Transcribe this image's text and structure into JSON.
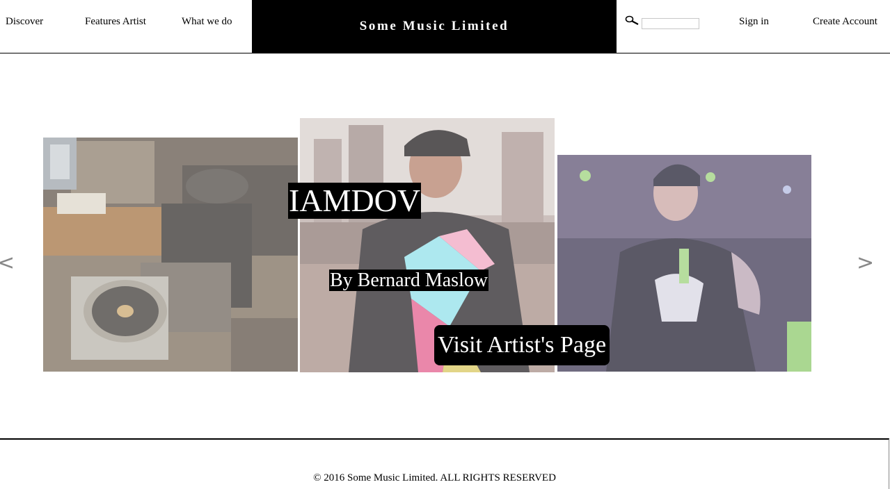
{
  "header": {
    "nav": {
      "discover": "Discover",
      "features_artist": "Features Artist",
      "what_we_do": "What we do"
    },
    "brand": "Some Music Limited",
    "search": {
      "value": "",
      "placeholder": ""
    },
    "account": {
      "sign_in": "Sign in",
      "create_account": "Create Account"
    }
  },
  "carousel": {
    "prev_label": "<",
    "next_label": ">",
    "artist_name": "IAMDOV",
    "byline": "By Bernard Maslow",
    "visit_button": "Visit Artist's Page",
    "photos": [
      {
        "subject": "man at turntable in studio"
      },
      {
        "subject": "man in cap facing skyline"
      },
      {
        "subject": "man on stage holding drink"
      }
    ]
  },
  "footer": {
    "copyright": "© 2016 Some Music Limited. ALL RIGHTS RESERVED"
  },
  "colors": {
    "brand_bg": "#000000",
    "brand_text": "#ffffff",
    "arrow": "#888888"
  }
}
